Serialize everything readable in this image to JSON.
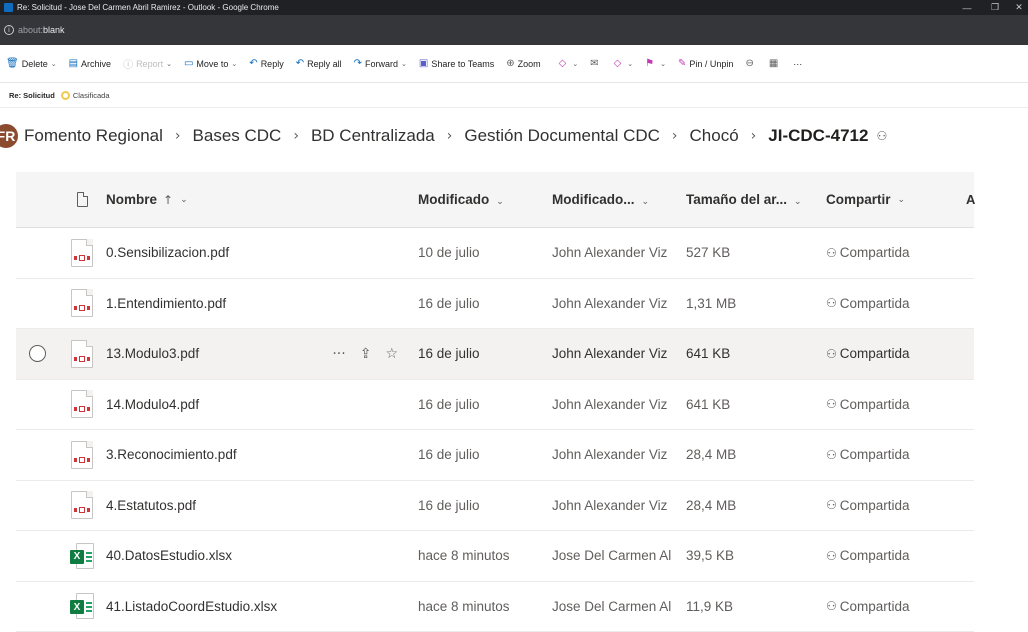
{
  "window": {
    "title": "Re: Solicitud - Jose Del Carmen Abril Ramirez - Outlook - Google Chrome",
    "url_scheme": "about:",
    "url_page": "blank"
  },
  "commands": [
    {
      "label": "Delete",
      "icon": "delete-icon",
      "glyph": "🗑",
      "chevron": true,
      "disabled": false
    },
    {
      "label": "Archive",
      "icon": "archive-icon",
      "glyph": "▤",
      "chevron": false,
      "disabled": false
    },
    {
      "label": "Report",
      "icon": "report-icon",
      "glyph": "ⓘ",
      "chevron": true,
      "disabled": true
    },
    {
      "label": "Move to",
      "icon": "move-to-icon",
      "glyph": "▭",
      "chevron": true,
      "disabled": false
    },
    {
      "label": "Reply",
      "icon": "reply-icon",
      "glyph": "↶",
      "chevron": false,
      "disabled": false
    },
    {
      "label": "Reply all",
      "icon": "reply-all-icon",
      "glyph": "↶",
      "chevron": false,
      "disabled": false
    },
    {
      "label": "Forward",
      "icon": "forward-icon",
      "glyph": "↷",
      "chevron": true,
      "disabled": false
    },
    {
      "label": "Share to Teams",
      "icon": "teams-icon",
      "glyph": "▣",
      "chevron": false,
      "disabled": false
    },
    {
      "label": "Zoom",
      "icon": "zoom-icon",
      "glyph": "⊕",
      "chevron": false,
      "disabled": false
    }
  ],
  "commands_right": [
    {
      "label": "",
      "icon": "tag-icon",
      "glyph": "◇",
      "chevron": true
    },
    {
      "label": "",
      "icon": "mark-read-icon",
      "glyph": "✉",
      "chevron": false
    },
    {
      "label": "",
      "icon": "categorize-icon",
      "glyph": "◇",
      "chevron": true
    },
    {
      "label": "",
      "icon": "flag-icon",
      "glyph": "⚑",
      "chevron": true
    },
    {
      "label": "Pin / Unpin",
      "icon": "pin-icon",
      "glyph": "✎",
      "chevron": false
    },
    {
      "label": "",
      "icon": "immersive-reader-icon",
      "glyph": "⊖",
      "chevron": false
    },
    {
      "label": "",
      "icon": "apps-icon",
      "glyph": "▦",
      "chevron": false
    },
    {
      "label": "···",
      "icon": "more-icon",
      "glyph": "",
      "chevron": false
    }
  ],
  "subject": {
    "text": "Re: Solicitud",
    "tag": "Clasificada",
    "tag_color": "#f2c94c"
  },
  "breadcrumb": {
    "site_initials": "FR",
    "items": [
      "Fomento Regional",
      "Bases CDC",
      "BD Centralizada",
      "Gestión Documental CDC",
      "Chocó"
    ],
    "current": "JI-CDC-4712",
    "separator": "›"
  },
  "table": {
    "columns": {
      "name": "Nombre",
      "modified": "Modificado",
      "modified_by": "Modificado...",
      "size": "Tamaño del ar...",
      "sharing": "Compartir",
      "extra": "A"
    },
    "rows": [
      {
        "type": "pdf",
        "name": "0.Sensibilizacion.pdf",
        "modified": "10 de julio",
        "modified_by": "John Alexander Viz",
        "size": "527 KB",
        "sharing": "Compartida",
        "selected": false
      },
      {
        "type": "pdf",
        "name": "1.Entendimiento.pdf",
        "modified": "16 de julio",
        "modified_by": "John Alexander Viz",
        "size": "1,31 MB",
        "sharing": "Compartida",
        "selected": false
      },
      {
        "type": "pdf",
        "name": "13.Modulo3.pdf",
        "modified": "16 de julio",
        "modified_by": "John Alexander Viz",
        "size": "641 KB",
        "sharing": "Compartida",
        "selected": true
      },
      {
        "type": "pdf",
        "name": "14.Modulo4.pdf",
        "modified": "16 de julio",
        "modified_by": "John Alexander Viz",
        "size": "641 KB",
        "sharing": "Compartida",
        "selected": false
      },
      {
        "type": "pdf",
        "name": "3.Reconocimiento.pdf",
        "modified": "16 de julio",
        "modified_by": "John Alexander Viz",
        "size": "28,4 MB",
        "sharing": "Compartida",
        "selected": false
      },
      {
        "type": "pdf",
        "name": "4.Estatutos.pdf",
        "modified": "16 de julio",
        "modified_by": "John Alexander Viz",
        "size": "28,4 MB",
        "sharing": "Compartida",
        "selected": false
      },
      {
        "type": "xlsx",
        "name": "40.DatosEstudio.xlsx",
        "modified": "hace 8 minutos",
        "modified_by": "Jose Del Carmen Al",
        "size": "39,5 KB",
        "sharing": "Compartida",
        "selected": false
      },
      {
        "type": "xlsx",
        "name": "41.ListadoCoordEstudio.xlsx",
        "modified": "hace 8 minutos",
        "modified_by": "Jose Del Carmen Al",
        "size": "11,9 KB",
        "sharing": "Compartida",
        "selected": false
      }
    ]
  }
}
